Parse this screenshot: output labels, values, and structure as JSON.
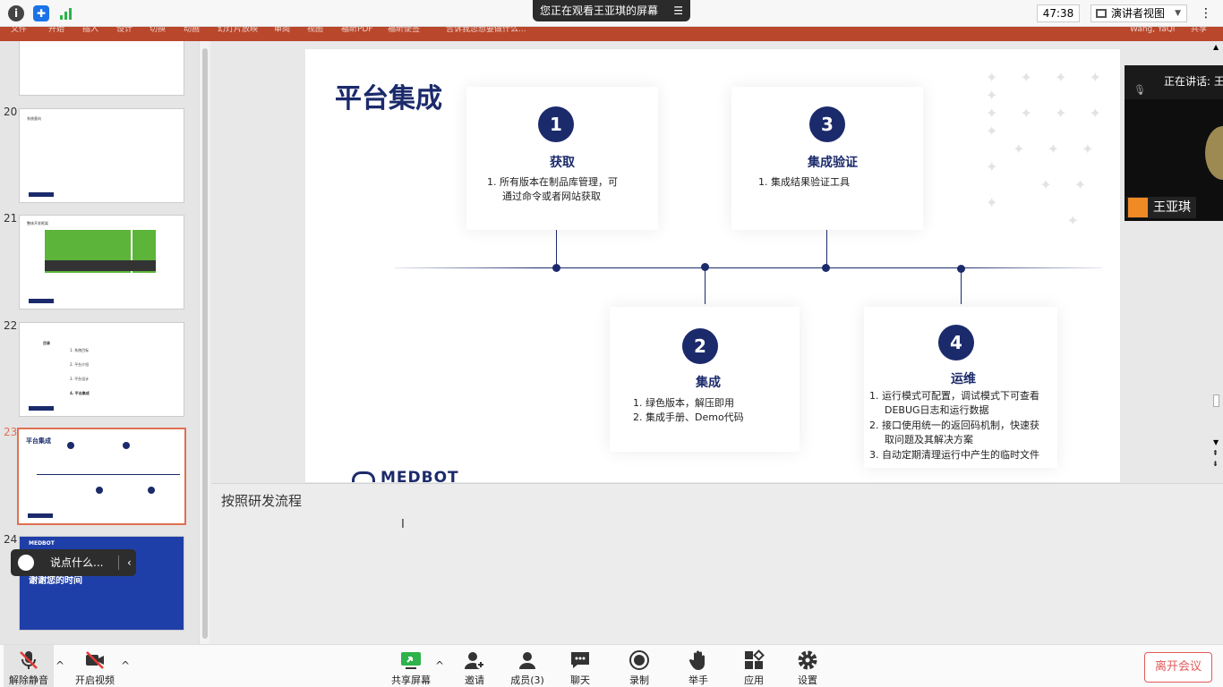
{
  "topbar": {
    "share_banner": "您正在观看王亚琪的屏幕",
    "timer": "47:38",
    "view_mode": "演讲者视图"
  },
  "ribbon": {
    "tabs": [
      "文件",
      "开始",
      "插入",
      "设计",
      "切换",
      "动画",
      "幻灯片放映",
      "审阅",
      "视图",
      "福昕PDF",
      "福昕便签",
      "告诉我您想要做什么..."
    ],
    "user": "Wang, YaQi",
    "share": "共享"
  },
  "thumbnails": [
    {
      "num": "",
      "title": ""
    },
    {
      "num": "20",
      "title": "系统意向"
    },
    {
      "num": "21",
      "title": "整体开发框架"
    },
    {
      "num": "22",
      "title": "目录",
      "items": [
        "1. 系统目标",
        "2. 平台介绍",
        "3. 平台设计",
        "4. 平台集成"
      ]
    },
    {
      "num": "23",
      "title": "平台集成"
    },
    {
      "num": "24",
      "title": "谢谢您的时间"
    }
  ],
  "slide": {
    "title": "平台集成",
    "cards": [
      {
        "num": "1",
        "title": "获取",
        "lines": [
          "1.  所有版本在制品库管理，可",
          "通过命令或者网站获取"
        ]
      },
      {
        "num": "3",
        "title": "集成验证",
        "lines": [
          "1.  集成结果验证工具"
        ]
      },
      {
        "num": "2",
        "title": "集成",
        "lines": [
          "1.  绿色版本，解压即用",
          "2.  集成手册、Demo代码"
        ]
      },
      {
        "num": "4",
        "title": "运维",
        "lines": [
          "1.  运行模式可配置，调试模式下可查看",
          "DEBUG日志和运行数据",
          "2.  接口使用统一的返回码机制，快速获",
          "取问题及其解决方案",
          "3.  自动定期清理运行中产生的临时文件"
        ]
      }
    ],
    "logo": "MEDBOT"
  },
  "notes": {
    "text": "按照研发流程"
  },
  "video": {
    "speaking": "正在讲话: 王",
    "name": "王亚琪"
  },
  "chat": {
    "placeholder": "说点什么..."
  },
  "toolbar": {
    "mute": "解除静音",
    "video": "开启视频",
    "share": "共享屏幕",
    "invite": "邀请",
    "members": "成员(3)",
    "chat": "聊天",
    "record": "录制",
    "raise": "举手",
    "apps": "应用",
    "settings": "设置",
    "leave": "离开会议"
  },
  "colors": {
    "brand_navy": "#1b2a6b",
    "ribbon": "#b9472b",
    "share_green": "#2db34a",
    "leave_red": "#e05a5a"
  }
}
